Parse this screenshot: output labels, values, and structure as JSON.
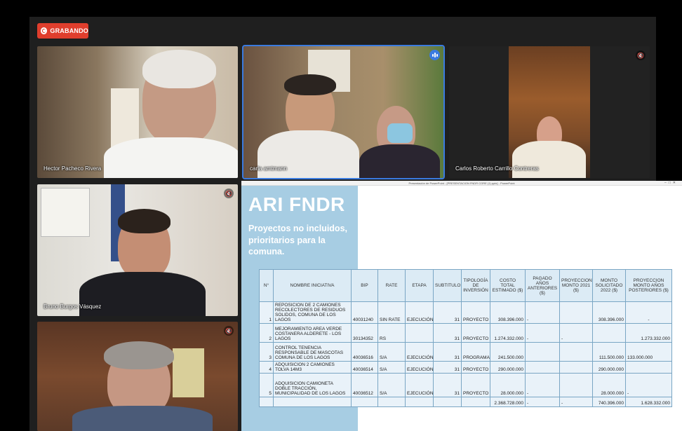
{
  "recording": {
    "label": "GRABANDO"
  },
  "participants": [
    {
      "name": "Hector Pacheco Rivera"
    },
    {
      "name": "carla amtmann"
    },
    {
      "name": "Carlos Roberto Carrillo Contreras"
    },
    {
      "name": "Bruno Burgos Vásquez"
    },
    {
      "name": ""
    }
  ],
  "ppt": {
    "window_title": "Presentación de PowerPoint - [PRESENTACION FNDR CORE (1).pptx] - PowerPoint",
    "slide_title": "ARI FNDR",
    "subtitle": "Proyectos no incluidos, prioritarios para la comuna.",
    "table": {
      "headers": [
        "N°",
        "NOMBRE INICIATIVA",
        "BIP",
        "RATE",
        "ETAPA",
        "SUBTITULO",
        "TIPOLOGÍA DE INVERSIÓN",
        "COSTO TOTAL ESTIMADO ($)",
        "PAGADO AÑOS ANTERIORES ($)",
        "PROYECCION MONTO 2021 ($)",
        "MONTO SOLICITADO 2022 ($)",
        "PROYECCION MONTO AÑOS POSTERIORES ($)"
      ],
      "rows": [
        [
          "1",
          "REPOSICION DE 2 CAMIONES RECOLECTORES DE RESIDUOS SOLIDOS, COMUNA DE LOS LAGOS",
          "40031240",
          "SIN RATE",
          "EJECUCIÓN",
          "31",
          "PROYECTO",
          "308.396.000",
          "-",
          "",
          "308.396.000",
          "-"
        ],
        [
          "2",
          "MEJORAMIENTO AREA VERDE COSTANERA ALDERETE - LOS LAGOS",
          "30134352",
          "RS",
          "",
          "31",
          "PROYECTO",
          "1.274.332.000",
          "-",
          "-",
          "",
          "1.273.332.000"
        ],
        [
          "3",
          "CONTROL TENENCIA RESPONSABLE DE MASCOTAS COMUNA DE LOS LAGOS",
          "40036516",
          "S/A",
          "EJECUCIÓN",
          "31",
          "PROGRAMA",
          "241.500.000",
          "",
          "",
          "111.500.000",
          "133.000.000"
        ],
        [
          "4",
          "ADQUISICION 2 CAMIONES TOLVA 14M3",
          "40036514",
          "S/A",
          "EJECUCIÓN",
          "31",
          "PROYECTO",
          "290.000.000",
          "",
          "",
          "290.000.000",
          ""
        ],
        [
          "5",
          "ADQUISICION CAMIONETA DOBLE TRACCIÓN, MUNICIPALIDAD DE LOS LAGOS",
          "40036512",
          "S/A",
          "EJECUCIÓN",
          "31",
          "PROYECTO",
          "28.000.000",
          "-",
          "",
          "28.000.000",
          "-"
        ]
      ],
      "totals": [
        "",
        "",
        "",
        "",
        "",
        "",
        "",
        "2.368.728.000",
        "-",
        "-",
        "740.396.000",
        "1.628.332.000"
      ]
    }
  }
}
